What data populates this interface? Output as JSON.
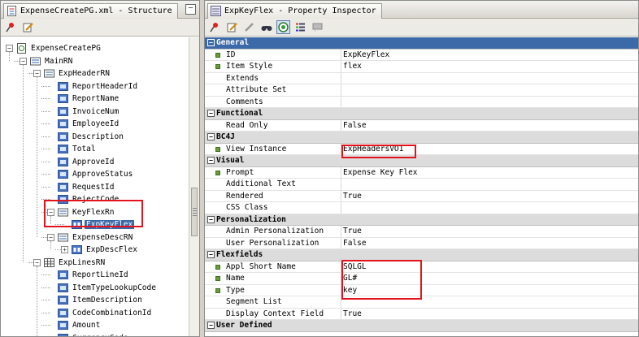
{
  "structure_pane": {
    "tab_title": "ExpenseCreatePG.xml - Structure",
    "minimize_label": "–",
    "tree": [
      {
        "label": "ExpenseCreatePG",
        "depth": 0,
        "expander": "−",
        "icon": "page-icon"
      },
      {
        "label": "MainRN",
        "depth": 1,
        "expander": "−",
        "icon": "region-icon"
      },
      {
        "label": "ExpHeaderRN",
        "depth": 2,
        "expander": "−",
        "icon": "region-icon"
      },
      {
        "label": "ReportHeaderId",
        "depth": 3,
        "icon": "item-icon"
      },
      {
        "label": "ReportName",
        "depth": 3,
        "icon": "item-icon"
      },
      {
        "label": "InvoiceNum",
        "depth": 3,
        "icon": "item-icon"
      },
      {
        "label": "EmployeeId",
        "depth": 3,
        "icon": "item-icon"
      },
      {
        "label": "Description",
        "depth": 3,
        "icon": "item-icon"
      },
      {
        "label": "Total",
        "depth": 3,
        "icon": "item-icon"
      },
      {
        "label": "ApproveId",
        "depth": 3,
        "icon": "item-icon"
      },
      {
        "label": "ApproveStatus",
        "depth": 3,
        "icon": "item-icon"
      },
      {
        "label": "RequestId",
        "depth": 3,
        "icon": "item-icon"
      },
      {
        "label": "RejectCode",
        "depth": 3,
        "icon": "item-icon"
      },
      {
        "label": "KeyFlexRn",
        "depth": 3,
        "expander": "−",
        "icon": "region-icon"
      },
      {
        "label": "ExpKeyFlex",
        "depth": 4,
        "icon": "flex-icon",
        "selected": true
      },
      {
        "label": "ExpenseDescRN",
        "depth": 3,
        "expander": "−",
        "icon": "region-icon"
      },
      {
        "label": "ExpDescFlex",
        "depth": 4,
        "expander": "+",
        "icon": "flex-icon"
      },
      {
        "label": "ExpLinesRN",
        "depth": 2,
        "expander": "−",
        "icon": "table-icon"
      },
      {
        "label": "ReportLineId",
        "depth": 3,
        "icon": "item-icon"
      },
      {
        "label": "ItemTypeLookupCode",
        "depth": 3,
        "icon": "item-icon"
      },
      {
        "label": "ItemDescription",
        "depth": 3,
        "icon": "item-icon"
      },
      {
        "label": "CodeCombinationId",
        "depth": 3,
        "icon": "item-icon"
      },
      {
        "label": "Amount",
        "depth": 3,
        "icon": "item-icon"
      },
      {
        "label": "CurrencyCode",
        "depth": 3,
        "icon": "item-icon"
      }
    ]
  },
  "inspector_pane": {
    "title": "ExpKeyFlex - Property Inspector",
    "toolbar": [
      "pin-icon",
      "edit-icon",
      "pencil-icon",
      "find-icon",
      "categorized-icon",
      "alphabetical-icon",
      "comment-icon"
    ],
    "categories": [
      {
        "name": "General",
        "expander": "−",
        "highlight": true,
        "rows": [
          {
            "name": "ID",
            "value": "ExpKeyFlex",
            "required": true
          },
          {
            "name": "Item Style",
            "value": "flex",
            "required": true
          },
          {
            "name": "Extends",
            "value": ""
          },
          {
            "name": "Attribute Set",
            "value": ""
          },
          {
            "name": "Comments",
            "value": ""
          }
        ]
      },
      {
        "name": "Functional",
        "expander": "−",
        "rows": [
          {
            "name": "Read Only",
            "value": "False"
          }
        ]
      },
      {
        "name": "BC4J",
        "expander": "−",
        "rows": [
          {
            "name": "View Instance",
            "value": "ExpHeadersVO1",
            "required": true
          }
        ]
      },
      {
        "name": "Visual",
        "expander": "−",
        "rows": [
          {
            "name": "Prompt",
            "value": "Expense Key Flex",
            "required": true
          },
          {
            "name": "Additional Text",
            "value": ""
          },
          {
            "name": "Rendered",
            "value": "True"
          },
          {
            "name": "CSS Class",
            "value": ""
          }
        ]
      },
      {
        "name": "Personalization",
        "expander": "−",
        "rows": [
          {
            "name": "Admin Personalization",
            "value": "True"
          },
          {
            "name": "User Personalization",
            "value": "False"
          }
        ]
      },
      {
        "name": "Flexfields",
        "expander": "−",
        "rows": [
          {
            "name": "Appl Short Name",
            "value": "SQLGL",
            "required": true
          },
          {
            "name": "Name",
            "value": "GL#",
            "required": true
          },
          {
            "name": "Type",
            "value": "key",
            "required": true
          },
          {
            "name": "Segment List",
            "value": ""
          },
          {
            "name": "Display Context Field",
            "value": "True"
          }
        ]
      },
      {
        "name": "User Defined",
        "expander": "−",
        "rows": []
      }
    ]
  },
  "colors": {
    "selection": "#3c6aa8",
    "highlight_box": "#e3131e",
    "required_marker": "#6a9c3a"
  }
}
